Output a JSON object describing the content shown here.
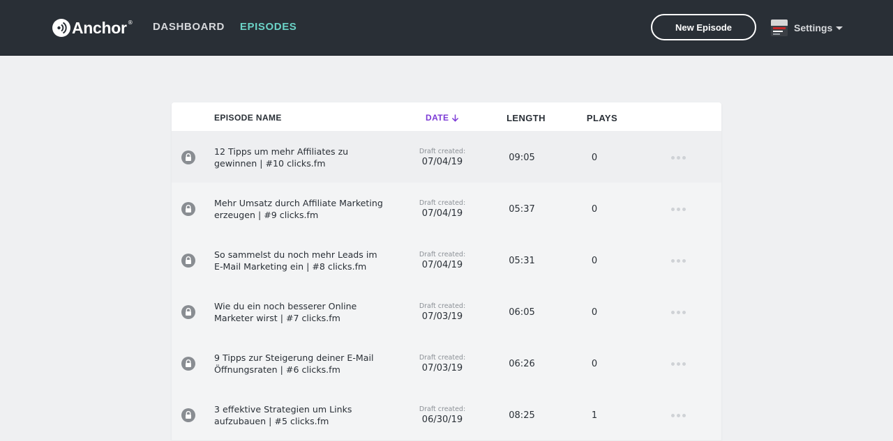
{
  "header": {
    "logo_text": "Anchor",
    "logo_reg": "®",
    "nav": [
      {
        "label": "DASHBOARD",
        "active": false
      },
      {
        "label": "EPISODES",
        "active": true
      }
    ],
    "new_episode_label": "New Episode",
    "settings_label": "Settings"
  },
  "table": {
    "columns": {
      "name": "EPISODE NAME",
      "date": "DATE",
      "length": "LENGTH",
      "plays": "PLAYS"
    },
    "rows": [
      {
        "title_line1": "12 Tipps um mehr Affiliates zu",
        "title_line2": "gewinnen | #10 clicks.fm",
        "draft_label": "Draft created:",
        "date": "07/04/19",
        "length": "09:05",
        "plays": "0"
      },
      {
        "title_line1": "Mehr Umsatz durch Affiliate Marketing",
        "title_line2": "erzeugen | #9 clicks.fm",
        "draft_label": "Draft created:",
        "date": "07/04/19",
        "length": "05:37",
        "plays": "0"
      },
      {
        "title_line1": "So sammelst du noch mehr Leads im",
        "title_line2": "E-Mail Marketing ein | #8 clicks.fm",
        "draft_label": "Draft created:",
        "date": "07/04/19",
        "length": "05:31",
        "plays": "0"
      },
      {
        "title_line1": "Wie du ein noch besserer Online",
        "title_line2": "Marketer wirst | #7 clicks.fm",
        "draft_label": "Draft created:",
        "date": "07/03/19",
        "length": "06:05",
        "plays": "0"
      },
      {
        "title_line1": "9 Tipps zur Steigerung deiner E-Mail",
        "title_line2": "Öffnungsraten | #6 clicks.fm",
        "draft_label": "Draft created:",
        "date": "07/03/19",
        "length": "06:26",
        "plays": "0"
      },
      {
        "title_line1": "3 effektive Strategien um Links",
        "title_line2": "aufzubauen | #5 clicks.fm",
        "draft_label": "Draft created:",
        "date": "06/30/19",
        "length": "08:25",
        "plays": "1"
      }
    ]
  },
  "icons": {
    "logo": "anchor-logo-icon",
    "row_status": "lock-icon",
    "row_menu": "more-dots-icon",
    "sort": "arrow-down-icon",
    "dropdown": "caret-down-icon"
  },
  "colors": {
    "topbar": "#292f36",
    "nav_active": "#6bd3c7",
    "sort_accent": "#7c3ad6",
    "page_bg": "#eff0f2"
  }
}
